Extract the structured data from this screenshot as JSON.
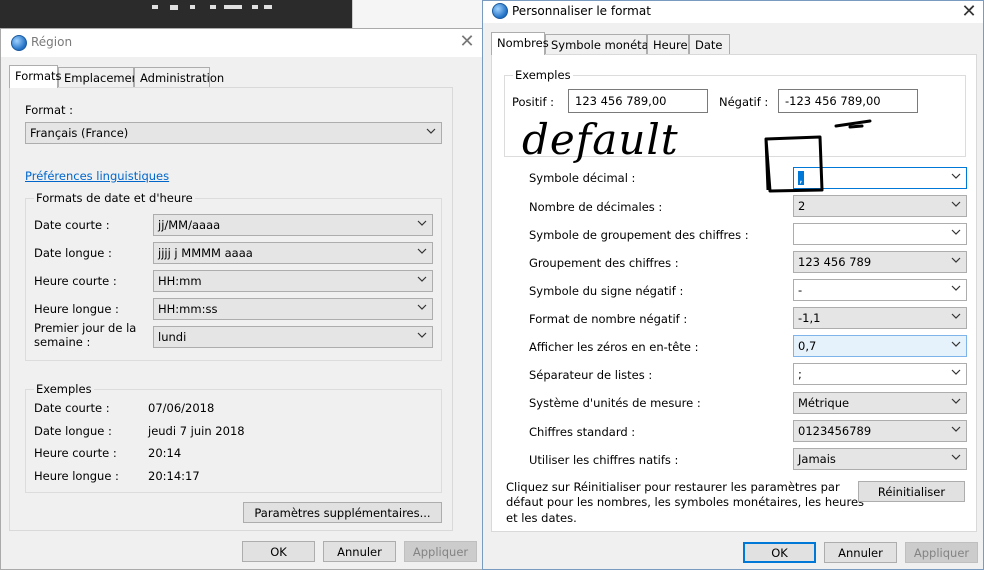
{
  "region_dialog": {
    "title": "Région",
    "tabs": [
      "Formats",
      "Emplacement",
      "Administration"
    ],
    "format_label": "Format :",
    "format_value": "Français (France)",
    "language_prefs_link": "Préférences linguistiques",
    "date_time_group": "Formats de date et d'heure",
    "rows": [
      {
        "label": "Date courte :",
        "value": "jj/MM/aaaa"
      },
      {
        "label": "Date longue :",
        "value": "jjjj j MMMM aaaa"
      },
      {
        "label": "Heure courte :",
        "value": "HH:mm"
      },
      {
        "label": "Heure longue :",
        "value": "HH:mm:ss"
      },
      {
        "label": "Premier jour de la semaine :",
        "value": "lundi"
      }
    ],
    "examples_group": "Exemples",
    "examples": [
      {
        "label": "Date courte :",
        "value": "07/06/2018"
      },
      {
        "label": "Date longue :",
        "value": "jeudi 7 juin 2018"
      },
      {
        "label": "Heure courte :",
        "value": "20:14"
      },
      {
        "label": "Heure longue :",
        "value": "20:14:17"
      }
    ],
    "more_settings_button": "Paramètres supplémentaires...",
    "ok_button": "OK",
    "cancel_button": "Annuler",
    "apply_button": "Appliquer"
  },
  "custom_dialog": {
    "title": "Personnaliser le format",
    "tabs": [
      "Nombres",
      "Symbole monétaire",
      "Heure",
      "Date"
    ],
    "examples_group": "Exemples",
    "positive_label": "Positif :",
    "positive_value": "123 456 789,00",
    "negative_label": "Négatif :",
    "negative_value": "-123 456 789,00",
    "settings": [
      {
        "label": "Symbole décimal :",
        "value": ","
      },
      {
        "label": "Nombre de décimales :",
        "value": "2"
      },
      {
        "label": "Symbole de groupement des chiffres :",
        "value": ""
      },
      {
        "label": "Groupement des chiffres :",
        "value": "123 456 789"
      },
      {
        "label": "Symbole du signe négatif :",
        "value": "-"
      },
      {
        "label": "Format de nombre négatif :",
        "value": "-1,1"
      },
      {
        "label": "Afficher les zéros en en-tête :",
        "value": "0,7"
      },
      {
        "label": "Séparateur de listes :",
        "value": ";"
      },
      {
        "label": "Système d'unités de mesure :",
        "value": "Métrique"
      },
      {
        "label": "Chiffres standard :",
        "value": "0123456789"
      },
      {
        "label": "Utiliser les chiffres natifs :",
        "value": "Jamais"
      }
    ],
    "reset_text_lines": [
      "Cliquez sur Réinitialiser pour restaurer les paramètres par",
      "défaut pour les nombres, les symboles monétaires, les heures",
      "et les dates."
    ],
    "reset_button": "Réinitialiser",
    "ok_button": "OK",
    "cancel_button": "Annuler",
    "apply_button": "Appliquer"
  },
  "annotation": {
    "handwritten_text": "default",
    "color": "#000000"
  },
  "colors": {
    "accent": "#0078d7",
    "link": "#0066cc",
    "dialog_bg": "#f0f0f0"
  }
}
